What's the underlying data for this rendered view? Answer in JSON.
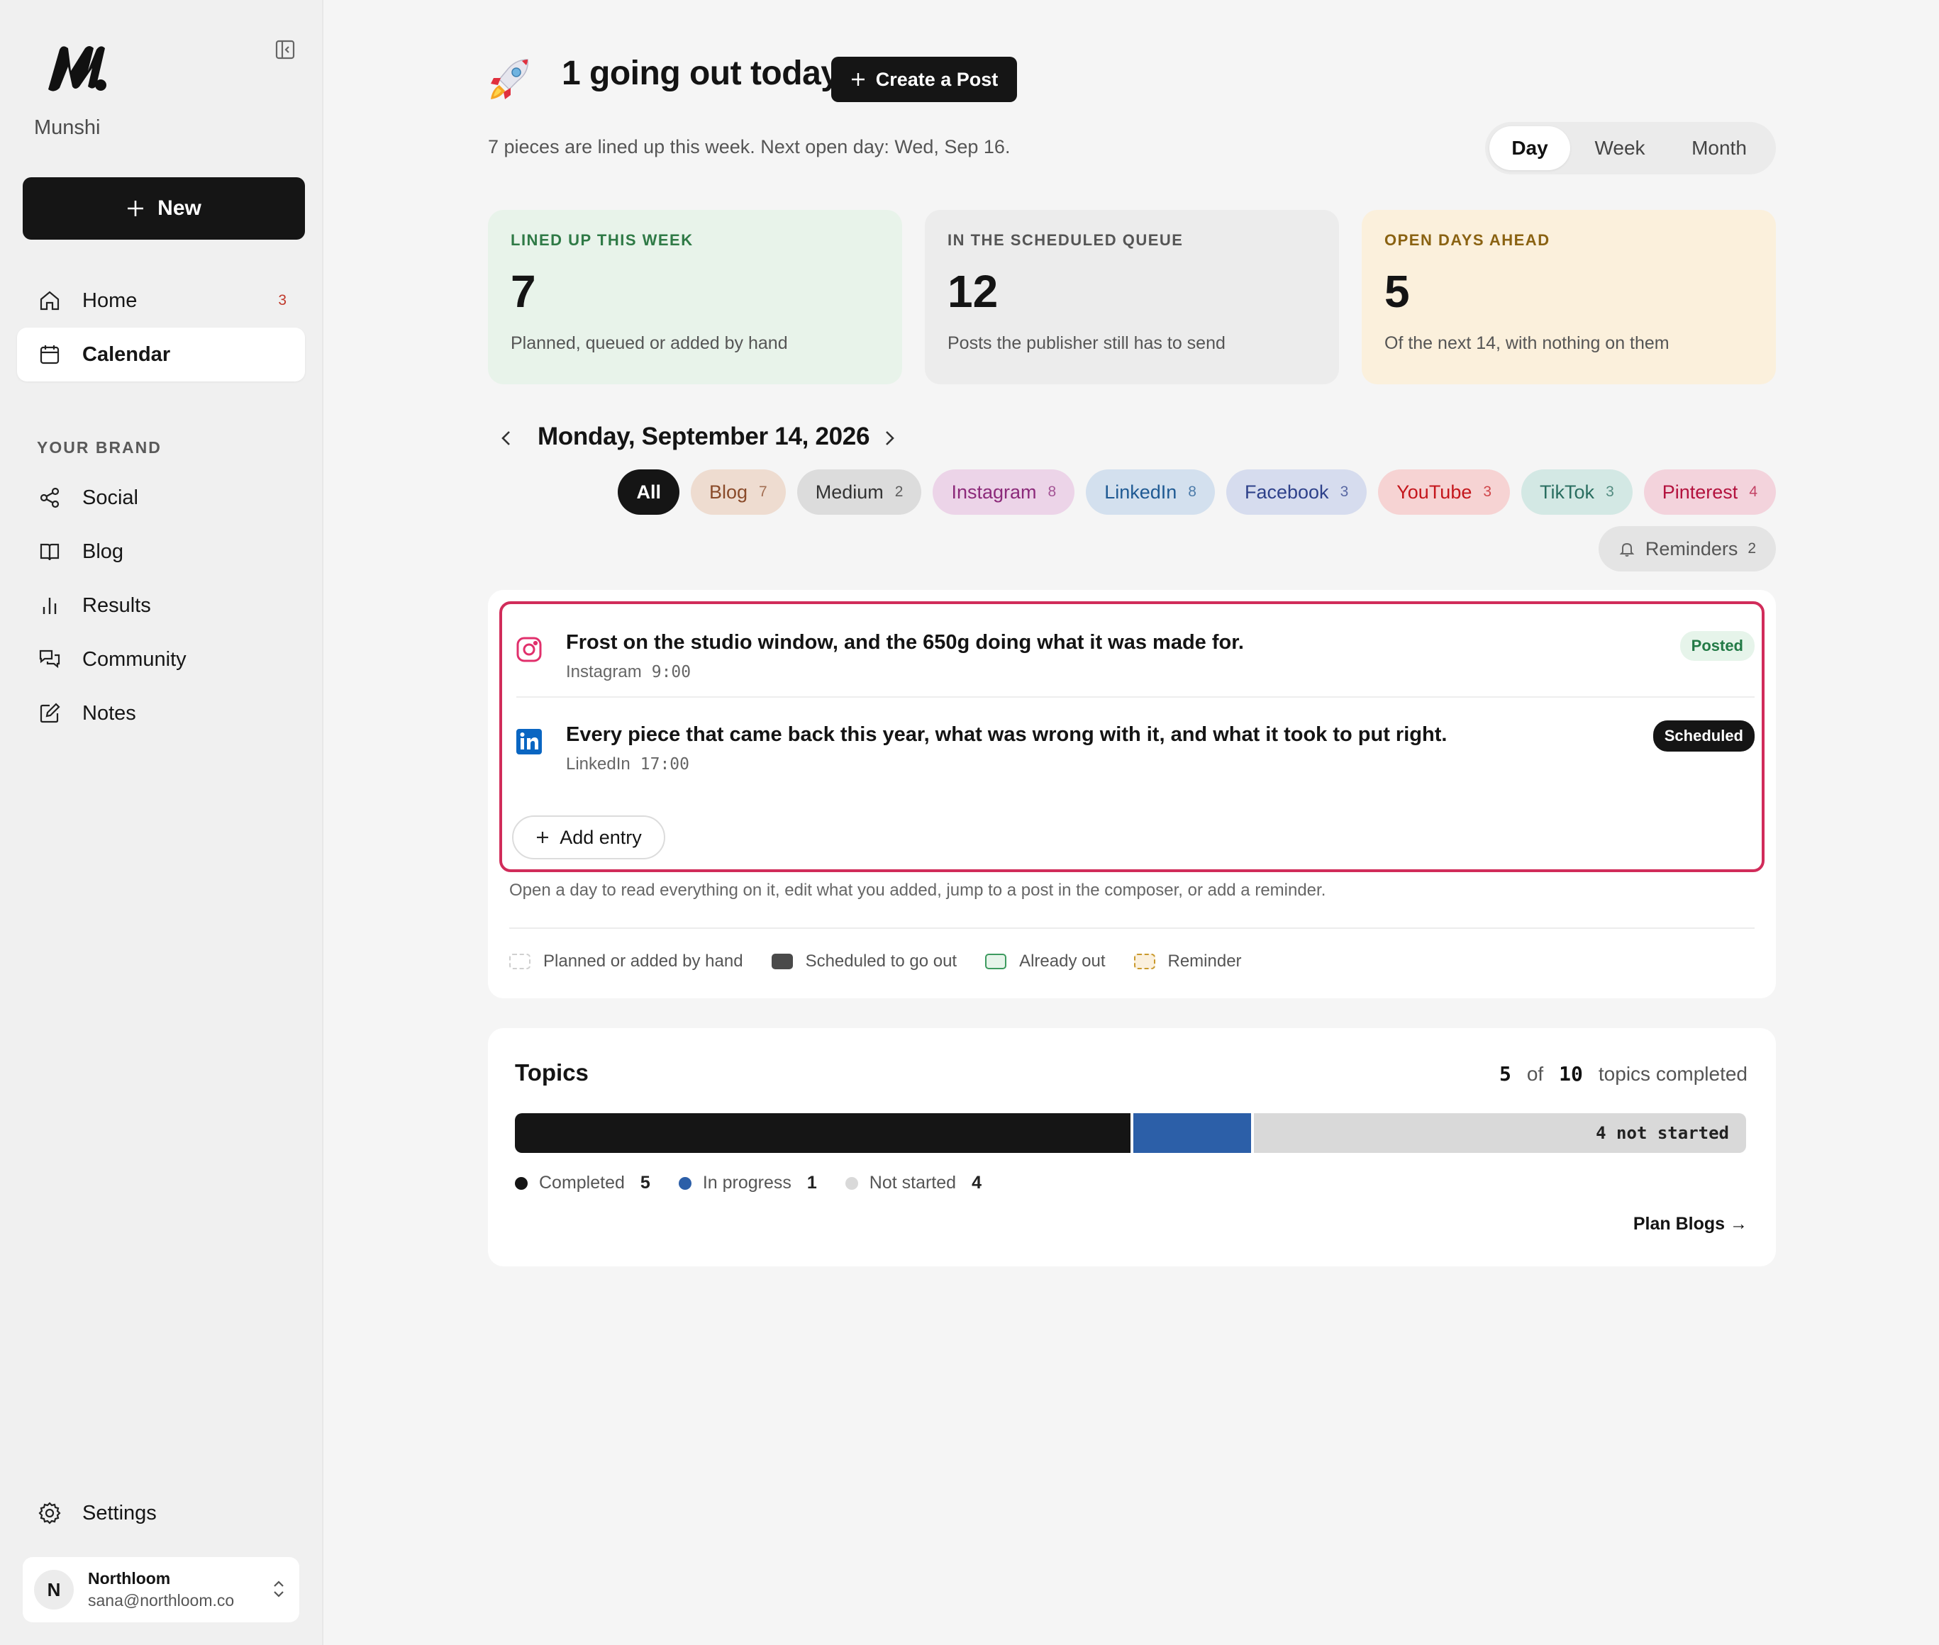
{
  "brand": {
    "name": "Munshi"
  },
  "sidebar": {
    "new_label": "New",
    "nav": [
      {
        "label": "Home",
        "badge": "3",
        "icon": "home-icon"
      },
      {
        "label": "Calendar",
        "icon": "calendar-icon",
        "active": true
      }
    ],
    "section_label": "YOUR BRAND",
    "brand_nav": [
      {
        "label": "Social",
        "icon": "share-icon"
      },
      {
        "label": "Blog",
        "icon": "book-icon"
      },
      {
        "label": "Results",
        "icon": "bar-chart-icon"
      },
      {
        "label": "Community",
        "icon": "chat-icon"
      },
      {
        "label": "Notes",
        "icon": "edit-icon"
      }
    ],
    "settings_label": "Settings",
    "account": {
      "initial": "N",
      "name": "Northloom",
      "email": "sana@northloom.co"
    }
  },
  "header": {
    "headline": "1 going out today",
    "create_label": "Create a Post",
    "subline": "7 pieces are lined up this week. Next open day: Wed, Sep 16.",
    "views": [
      "Day",
      "Week",
      "Month"
    ],
    "active_view": "Day"
  },
  "stats": [
    {
      "label": "LINED UP THIS WEEK",
      "value": "7",
      "desc": "Planned, queued or added by hand",
      "bg": "#e8f3ea",
      "label_color": "#2f7a46"
    },
    {
      "label": "IN THE SCHEDULED QUEUE",
      "value": "12",
      "desc": "Posts the publisher still has to send",
      "bg": "#ececec",
      "label_color": "#555555"
    },
    {
      "label": "OPEN DAYS AHEAD",
      "value": "5",
      "desc": "Of the next 14, with nothing on them",
      "bg": "#fbf0dc",
      "label_color": "#8a6212"
    }
  ],
  "day": {
    "title": "Monday, September 14, 2026",
    "filters": [
      {
        "label": "All"
      },
      {
        "label": "Blog",
        "count": "7",
        "bg": "#eedcd0",
        "color": "#8a4b2a"
      },
      {
        "label": "Medium",
        "count": "2",
        "bg": "#dcdcdc",
        "color": "#333333"
      },
      {
        "label": "Instagram",
        "count": "8",
        "bg": "#ecd4e8",
        "color": "#8c2a7a"
      },
      {
        "label": "LinkedIn",
        "count": "8",
        "bg": "#d3e0ee",
        "color": "#1f5a93"
      },
      {
        "label": "Facebook",
        "count": "3",
        "bg": "#d6dcee",
        "color": "#2e418a"
      },
      {
        "label": "YouTube",
        "count": "3",
        "bg": "#f6d3d3",
        "color": "#c4161c"
      },
      {
        "label": "TikTok",
        "count": "3",
        "bg": "#d3e8e4",
        "color": "#2a6e60"
      },
      {
        "label": "Pinterest",
        "count": "4",
        "bg": "#f3d3dc",
        "color": "#b3123e"
      }
    ],
    "reminders": {
      "label": "Reminders",
      "count": "2"
    },
    "entries": [
      {
        "title": "Frost on the studio window, and the 650g doing what it was made for.",
        "network": "Instagram",
        "time": "9:00",
        "status": "Posted"
      },
      {
        "title": "Every piece that came back this year, what was wrong with it, and what it took to put right.",
        "network": "LinkedIn",
        "time": "17:00",
        "status": "Scheduled"
      }
    ],
    "add_entry": "Add entry",
    "help": "Open a day to read everything on it, edit what you added, jump to a post in the composer, or add a reminder.",
    "legend": [
      "Planned or added by hand",
      "Scheduled to go out",
      "Already out",
      "Reminder"
    ]
  },
  "topics": {
    "title": "Topics",
    "done": "5",
    "of": "of",
    "total": "10",
    "suffix": "topics completed",
    "completed": 5,
    "in_progress": 1,
    "not_started": 4,
    "bar_label": "4 not started",
    "legend": [
      {
        "label": "Completed",
        "count": "5",
        "color": "#151515"
      },
      {
        "label": "In progress",
        "count": "1",
        "color": "#2c5fa8"
      },
      {
        "label": "Not started",
        "count": "4",
        "color": "#d9d9d9"
      }
    ],
    "plan_link": "Plan Blogs →"
  }
}
